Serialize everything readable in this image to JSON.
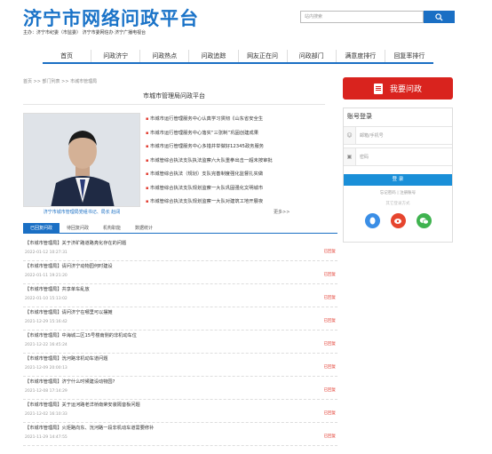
{
  "header": {
    "logo": "济宁市网络问政平台",
    "sponsor": "主办：济宁市纪委（市监委）  济宁市委网信办  济宁广播电视台",
    "search_placeholder": "站内搜索"
  },
  "nav": [
    "首页",
    "问政济宁",
    "问政热点",
    "问政追踪",
    "网友正在问",
    "问政部门",
    "满意度排行",
    "回复率排行"
  ],
  "breadcrumb": "首页 >> 部门列表 >> 市城市管理局",
  "section_title": "市城市管理局问政平台",
  "photo_caption": "济宁市城市管理局党组书记、局长 赵阔",
  "news": [
    "市城市运行管理服务中心认真学习贯彻《山东省安全生",
    "市城市运行管理服务中心落实“三张制”巩固创建成果",
    "市城市运行管理服务中心多措并举做好12345政务服务",
    "市城管综合执法支队执法监察六大队重拳出击一超未按审批",
    "市城管综合执法（规划）支队完善制度强化监督扎实做",
    "市城管综合执法支队规划监察一大队巩固强化文明城市",
    "市城管综合执法支队规划监察一大队对建筑工地开展夜"
  ],
  "more": "更多>>",
  "tabs": [
    "已回复问政",
    "待回复问政",
    "机构职能",
    "数据统计"
  ],
  "letters": [
    {
      "title": "【市城市管理局】关于济矿路道路亮化存在的问题",
      "date": "2022-01-12 10:27:31",
      "status": "已回复"
    },
    {
      "title": "【市城市管理局】请问济宁动物园何时建设",
      "date": "2022-01-11 19:21:20",
      "status": "已回复"
    },
    {
      "title": "【市城市管理局】共享单车乱放",
      "date": "2022-01-10 15:13:02",
      "status": "已回复"
    },
    {
      "title": "【市城市管理局】请问济宁在哪里可以摆摊",
      "date": "2021-12-29 15:16:42",
      "status": "已回复"
    },
    {
      "title": "【市城市管理局】中海城二区15号楼南侧的非机动车位",
      "date": "2021-12-22 16:45:24",
      "status": "已回复"
    },
    {
      "title": "【市城市管理局】洸河路非机动车道问题",
      "date": "2021-12-09 20:00:13",
      "status": "已回复"
    },
    {
      "title": "【市城市管理局】济宁什么时候建设动物园?",
      "date": "2021-12-08 17:14:29",
      "status": "已回复"
    },
    {
      "title": "【市城市管理局】关于运河路老洋桥南荣安装隔音板问题",
      "date": "2021-12-02 16:10:33",
      "status": "已回复"
    },
    {
      "title": "【市城市管理局】火炬路向东、洸河路一段非机动车道需要修补",
      "date": "2021-11-29 14:47:55",
      "status": "已回复"
    }
  ],
  "ask_button": "我要问政",
  "login": {
    "title": "账号登录",
    "email_placeholder": "邮箱/手机号",
    "password_placeholder": "密码",
    "submit": "登 录",
    "links": "忘记密码 | 注册账号",
    "other": "其它登录方式"
  },
  "colors": {
    "brand_blue": "#1a6fc4",
    "accent_red": "#d9231e"
  }
}
